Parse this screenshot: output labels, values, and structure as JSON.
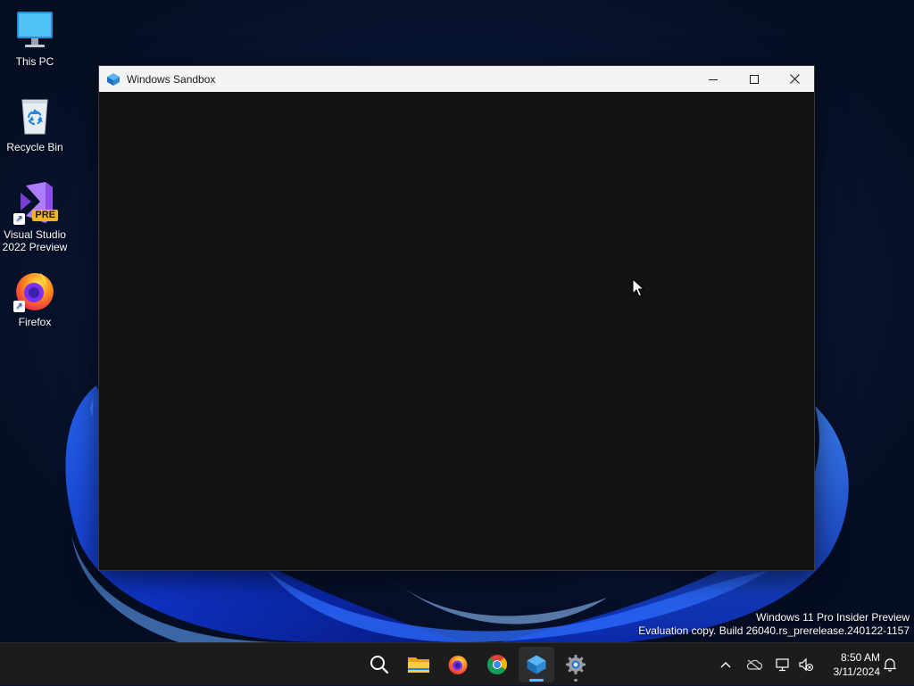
{
  "desktop": {
    "icons": [
      {
        "name": "this-pc",
        "label": "This PC"
      },
      {
        "name": "recycle-bin",
        "label": "Recycle Bin"
      },
      {
        "name": "visual-studio",
        "label": "Visual Studio 2022 Preview",
        "badge": "PRE"
      },
      {
        "name": "firefox",
        "label": "Firefox"
      }
    ]
  },
  "window": {
    "title": "Windows Sandbox",
    "icon": "windows-sandbox-icon",
    "body_color": "#121212"
  },
  "watermark": {
    "line1": "Windows 11 Pro Insider Preview",
    "line2": "Evaluation copy. Build 26040.rs_prerelease.240122-1157"
  },
  "taskbar": {
    "apps": [
      {
        "name": "search",
        "icon": "search-icon"
      },
      {
        "name": "file-explorer",
        "icon": "folder-icon"
      },
      {
        "name": "firefox",
        "icon": "firefox-icon"
      },
      {
        "name": "chrome",
        "icon": "chrome-icon"
      },
      {
        "name": "windows-sandbox",
        "icon": "windows-sandbox-icon",
        "active": true
      },
      {
        "name": "settings",
        "icon": "gear-icon"
      }
    ],
    "clock": {
      "time": "8:50 AM",
      "date": "3/11/2024"
    }
  },
  "colors": {
    "accent": "#4cc2ff",
    "taskbar": "#1c1c1c",
    "titlebar": "#f3f3f3"
  }
}
